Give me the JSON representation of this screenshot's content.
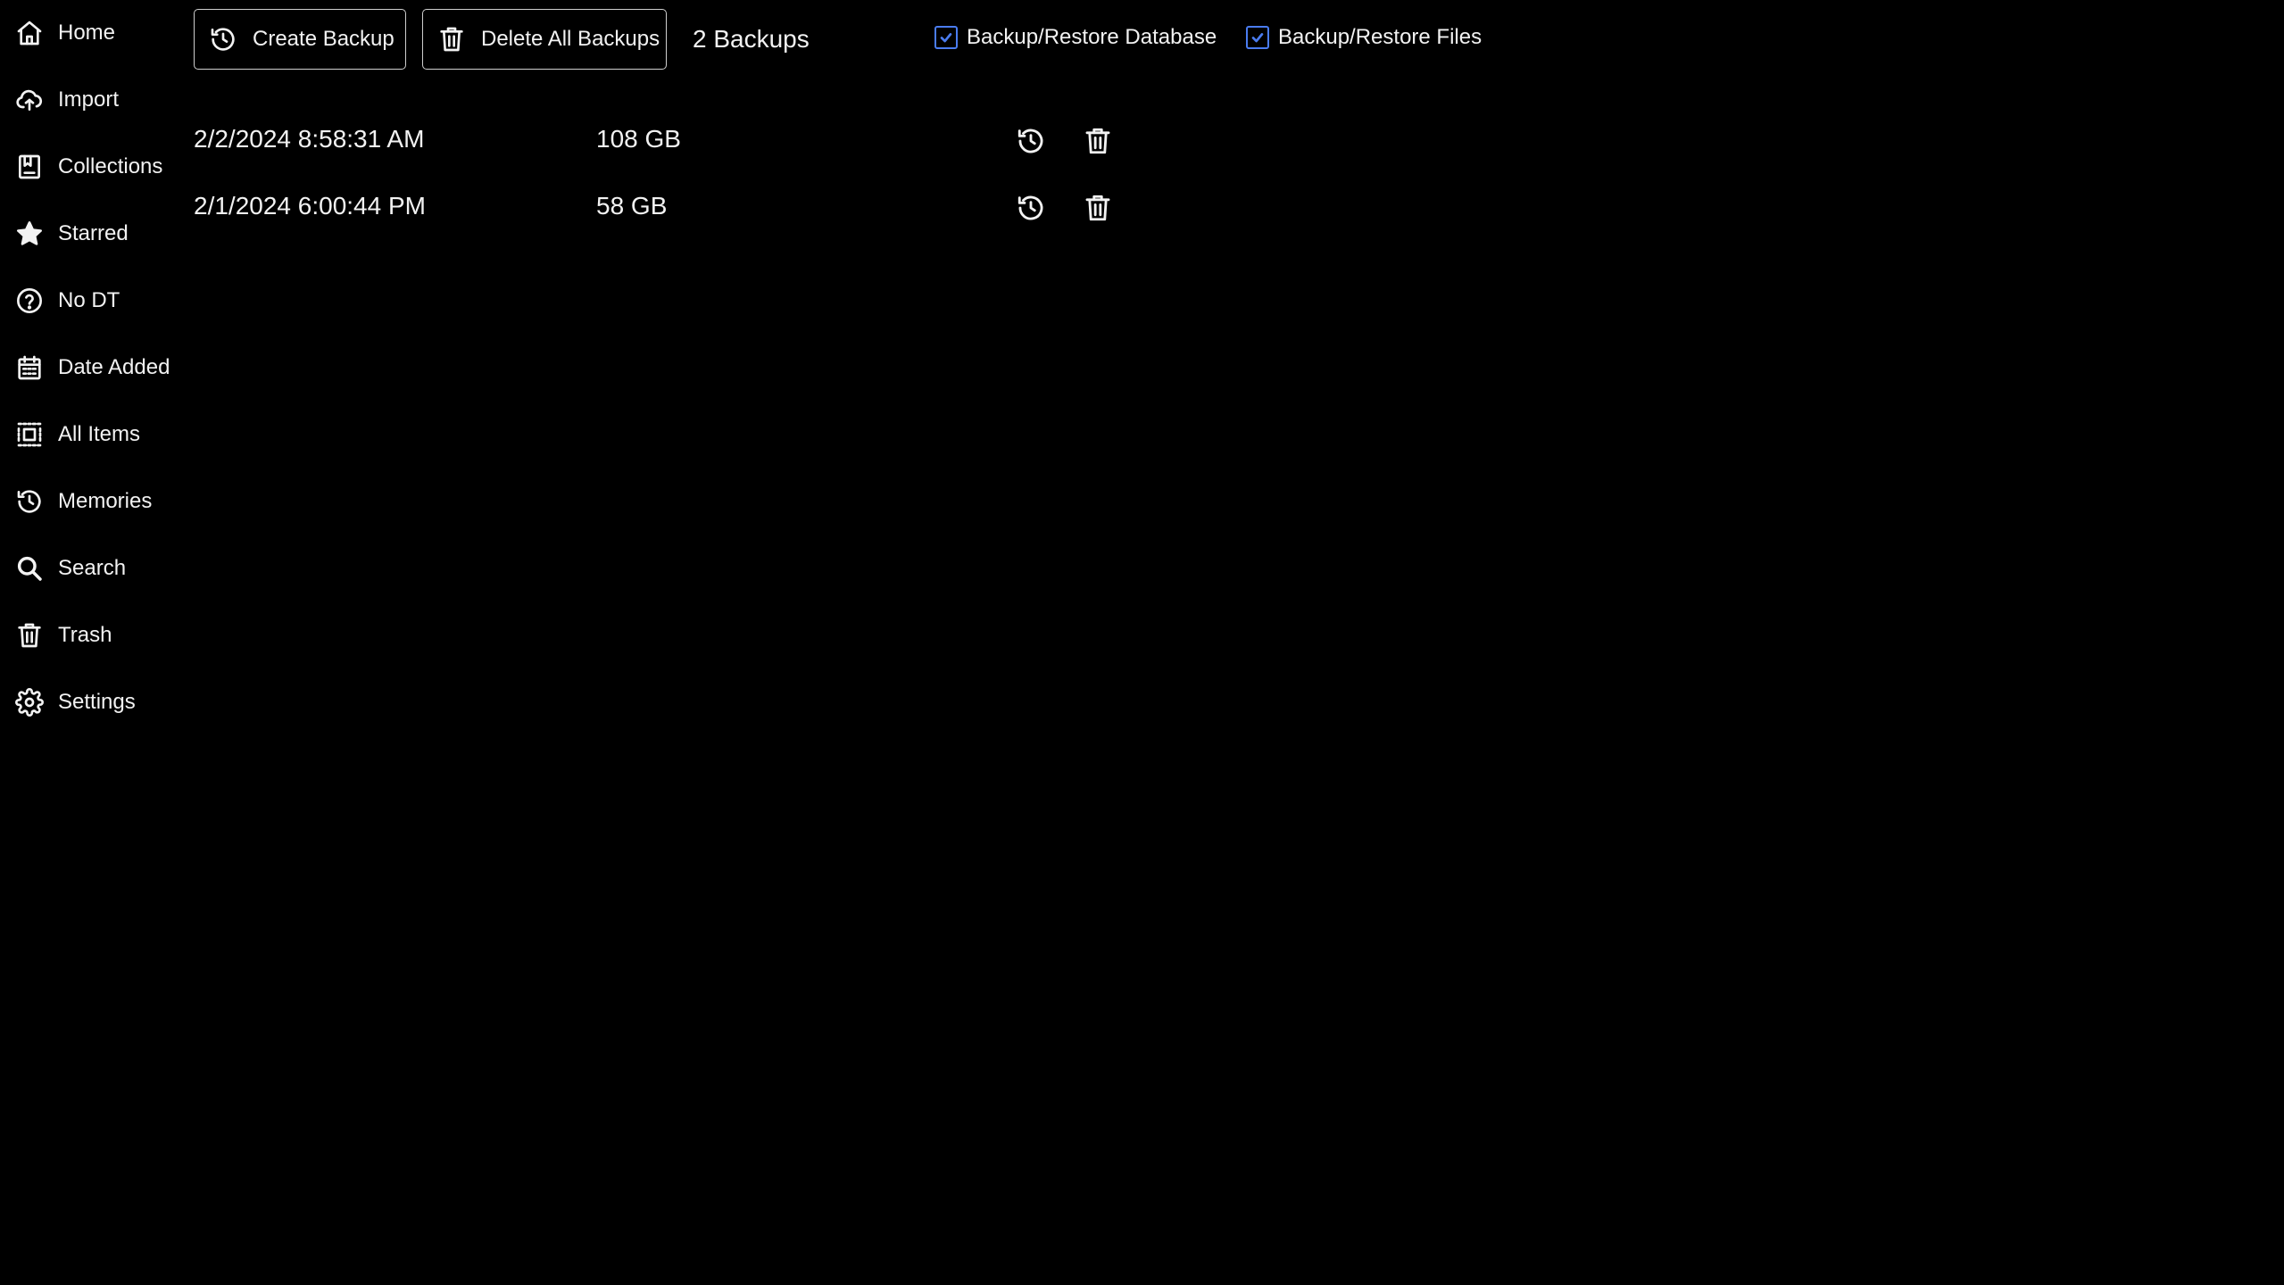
{
  "sidebar": {
    "items": [
      {
        "label": "Home",
        "icon": "home-icon"
      },
      {
        "label": "Import",
        "icon": "cloud-upload-icon"
      },
      {
        "label": "Collections",
        "icon": "collections-icon"
      },
      {
        "label": "Starred",
        "icon": "star-icon"
      },
      {
        "label": "No DT",
        "icon": "question-circle-icon"
      },
      {
        "label": "Date Added",
        "icon": "calendar-icon"
      },
      {
        "label": "All Items",
        "icon": "grid-dotted-icon"
      },
      {
        "label": "Memories",
        "icon": "history-icon"
      },
      {
        "label": "Search",
        "icon": "search-icon"
      },
      {
        "label": "Trash",
        "icon": "trash-icon"
      },
      {
        "label": "Settings",
        "icon": "gear-icon"
      }
    ]
  },
  "toolbar": {
    "create_backup_label": "Create Backup",
    "delete_all_label": "Delete All Backups",
    "backup_count": "2 Backups",
    "options": {
      "database": {
        "label": "Backup/Restore Database",
        "checked": true
      },
      "files": {
        "label": "Backup/Restore Files",
        "checked": true
      }
    }
  },
  "backups": [
    {
      "date": "2/2/2024 8:58:31 AM",
      "size": "108 GB"
    },
    {
      "date": "2/1/2024 6:00:44 PM",
      "size": "58 GB"
    }
  ],
  "colors": {
    "background": "#000000",
    "text": "#f2f2f2",
    "accent": "#4a7cf0",
    "button_border": "#cfcfcf"
  }
}
